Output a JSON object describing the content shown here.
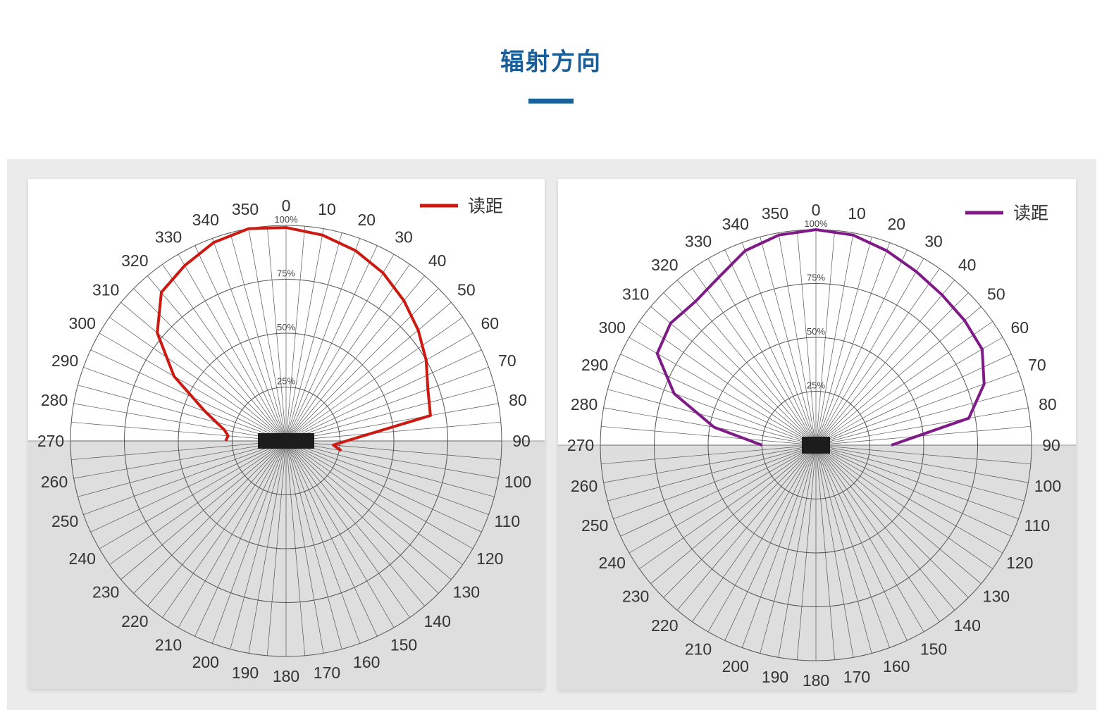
{
  "header": {
    "title": "辐射方向"
  },
  "chart_data": [
    {
      "type": "polar",
      "series": [
        {
          "name": "读距",
          "color": "#cc1a12"
        }
      ],
      "angle_ticks": [
        "0",
        "10",
        "20",
        "30",
        "40",
        "50",
        "60",
        "70",
        "80",
        "90",
        "100",
        "110",
        "120",
        "130",
        "140",
        "150",
        "160",
        "170",
        "180",
        "190",
        "200",
        "210",
        "220",
        "230",
        "240",
        "250",
        "260",
        "270",
        "280",
        "290",
        "300",
        "310",
        "320",
        "330",
        "340",
        "350"
      ],
      "radial_ticks": [
        "25%",
        "50%",
        "75%",
        "100%"
      ],
      "angles": [
        270,
        275,
        280,
        290,
        300,
        310,
        320,
        330,
        340,
        350,
        0,
        10,
        20,
        30,
        40,
        50,
        60,
        70,
        80,
        90,
        95,
        100
      ],
      "values": [
        28,
        27,
        29,
        40,
        60,
        78,
        90,
        94,
        98,
        100,
        99,
        97,
        94,
        90,
        85,
        80,
        75,
        70,
        68,
        28,
        22,
        26
      ],
      "rmax": 100,
      "shaded_half": "lower"
    },
    {
      "type": "polar",
      "series": [
        {
          "name": "读距",
          "color": "#7f1a88"
        }
      ],
      "angle_ticks": [
        "0",
        "10",
        "20",
        "30",
        "40",
        "50",
        "60",
        "70",
        "80",
        "90",
        "100",
        "110",
        "120",
        "130",
        "140",
        "150",
        "160",
        "170",
        "180",
        "190",
        "200",
        "210",
        "220",
        "230",
        "240",
        "250",
        "260",
        "270",
        "280",
        "290",
        "300",
        "310",
        "320",
        "330",
        "340",
        "350"
      ],
      "radial_ticks": [
        "25%",
        "50%",
        "75%",
        "100%"
      ],
      "angles": [
        270,
        280,
        290,
        300,
        310,
        320,
        330,
        340,
        350,
        0,
        10,
        20,
        30,
        40,
        50,
        60,
        70,
        80,
        90
      ],
      "values": [
        25,
        48,
        70,
        85,
        88,
        87,
        90,
        96,
        99,
        100,
        99,
        96,
        93,
        91,
        90,
        89,
        83,
        72,
        35
      ],
      "rmax": 100,
      "shaded_half": "lower"
    }
  ]
}
